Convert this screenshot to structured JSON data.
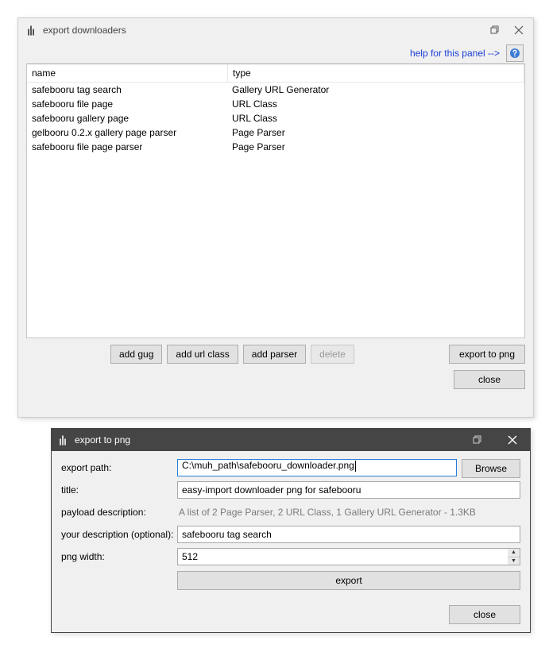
{
  "win1": {
    "title": "export downloaders",
    "help_link": "help for this panel -->",
    "columns": {
      "name": "name",
      "type": "type"
    },
    "rows": [
      {
        "name": "safebooru tag search",
        "type": "Gallery URL Generator"
      },
      {
        "name": "safebooru file page",
        "type": "URL Class"
      },
      {
        "name": "safebooru gallery page",
        "type": "URL Class"
      },
      {
        "name": "gelbooru 0.2.x gallery page parser",
        "type": "Page Parser"
      },
      {
        "name": "safebooru file page parser",
        "type": "Page Parser"
      }
    ],
    "buttons": {
      "add_gug": "add gug",
      "add_url_class": "add url class",
      "add_parser": "add parser",
      "delete": "delete",
      "export_to_png": "export to png",
      "close": "close"
    }
  },
  "win2": {
    "title": "export to png",
    "labels": {
      "export_path": "export path:",
      "title": "title:",
      "payload_description": "payload description:",
      "your_description": "your description (optional):",
      "png_width": "png width:"
    },
    "values": {
      "export_path": "C:\\muh_path\\safebooru_downloader.png",
      "title": "easy-import downloader png for safebooru",
      "payload_description_text": "A list of 2 Page Parser, 2 URL Class, 1 Gallery URL Generator - 1.3KB",
      "your_description": "safebooru tag search",
      "png_width": "512"
    },
    "buttons": {
      "browse": "Browse",
      "export": "export",
      "close": "close"
    }
  }
}
